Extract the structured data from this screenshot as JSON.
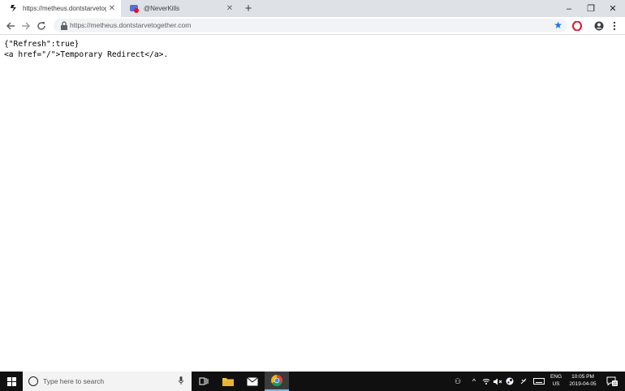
{
  "browser": {
    "tabs": [
      {
        "title": "https://metheus.dontstarvetogeth",
        "active": true,
        "favicon": "dst-icon"
      },
      {
        "title": "@NeverKills",
        "active": false,
        "favicon": "youtube-icon"
      }
    ],
    "new_tab_symbol": "+",
    "window_controls": {
      "minimize": "–",
      "restore": "❐",
      "close": "✕"
    },
    "address_bar": {
      "url": "https://metheus.dontstarvetogether.com"
    }
  },
  "page": {
    "line1": "{\"Refresh\":true}",
    "line2": "<a href=\"/\">Temporary Redirect</a>."
  },
  "taskbar": {
    "search_placeholder": "Type here to search",
    "language": "ENG",
    "region": "US",
    "time": "10:05 PM",
    "date": "2019-04-05",
    "notification_count": "11"
  },
  "colors": {
    "accent": "#1a73e8",
    "opera_red": "#e0122f",
    "taskbar_bg": "#101010"
  }
}
